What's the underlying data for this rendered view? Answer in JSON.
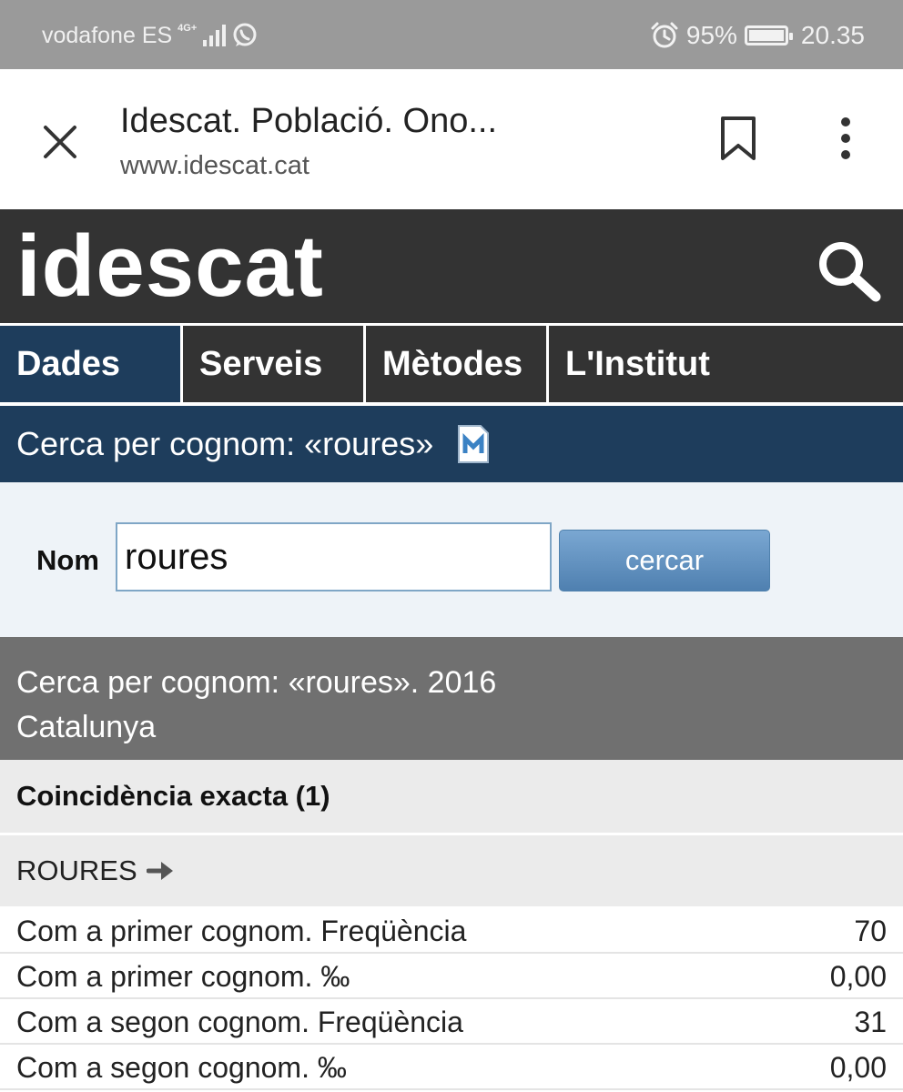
{
  "status_bar": {
    "carrier": "vodafone ES",
    "network": "4G+",
    "battery_percent": "95%",
    "time": "20.35"
  },
  "browser": {
    "page_title": "Idescat. Població. Ono...",
    "url": "www.idescat.cat"
  },
  "site": {
    "logo": "idescat"
  },
  "nav": {
    "tabs": [
      {
        "label": "Dades",
        "active": true
      },
      {
        "label": "Serveis",
        "active": false
      },
      {
        "label": "Mètodes",
        "active": false
      },
      {
        "label": "L'Institut",
        "active": false
      }
    ]
  },
  "section": {
    "title": "Cerca per cognom: «roures»"
  },
  "search_form": {
    "label": "Nom",
    "value": "roures",
    "button": "cercar"
  },
  "results": {
    "title": "Cerca per cognom: «roures». 2016",
    "region": "Catalunya",
    "match_header": "Coincidència exacta (1)",
    "surname": "ROURES",
    "rows": [
      {
        "label": "Com a primer cognom. Freqüència",
        "value": "70"
      },
      {
        "label": "Com a primer cognom. ‰",
        "value": "0,00"
      },
      {
        "label": "Com a segon cognom. Freqüència",
        "value": "31"
      },
      {
        "label": "Com a segon cognom. ‰",
        "value": "0,00"
      }
    ]
  },
  "colors": {
    "header_dark": "#333333",
    "nav_active": "#1e3d5c",
    "results_header": "#707070",
    "button": "#5b8cbd"
  }
}
